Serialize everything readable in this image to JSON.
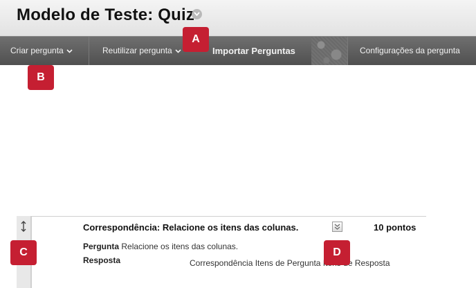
{
  "header": {
    "title": "Modelo de Teste: Quiz"
  },
  "action_bar": {
    "items": [
      {
        "label": "Criar pergunta"
      },
      {
        "label": "Reutilizar pergunta"
      },
      {
        "label": "Importar Perguntas"
      },
      {
        "label": "Configurações da pergunta"
      }
    ]
  },
  "callouts": {
    "a": "A",
    "b": "B",
    "c": "C",
    "d": "D"
  },
  "question": {
    "title": "Correspondência: Relacione os itens das colunas.",
    "points": "10 pontos",
    "question_label": "Pergunta",
    "question_text": "Relacione os itens das colunas.",
    "answer_label": "Resposta",
    "answer_detail": "Correspondência Itens de Pergunta Itens de Resposta"
  },
  "colors": {
    "callout": "#c51f32",
    "action_bar": "#5f5f5f"
  },
  "icons": [
    "chevron-down-icon",
    "drag-handle-icon",
    "menu-chevron-icon"
  ]
}
